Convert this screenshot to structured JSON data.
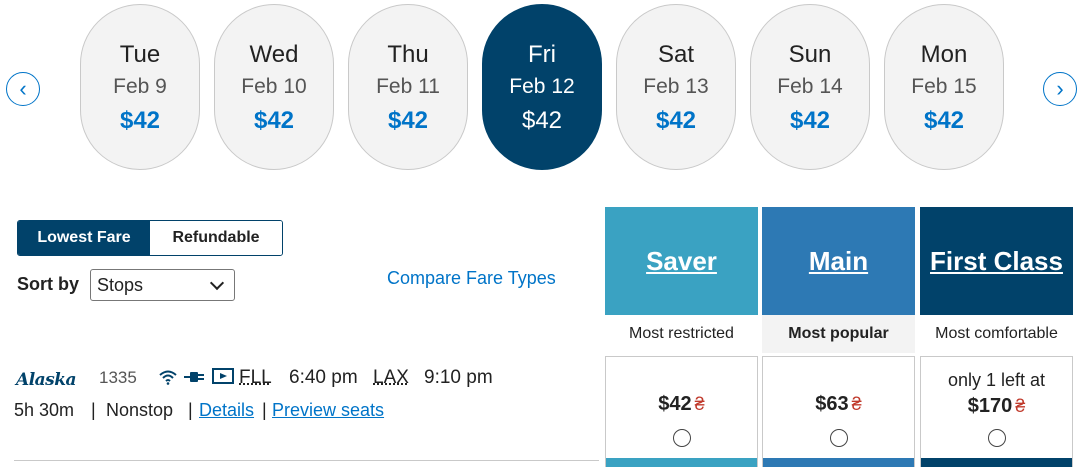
{
  "date_strip": {
    "prev_icon": "chevron-left-icon",
    "next_icon": "chevron-right-icon",
    "prev_glyph": "‹",
    "next_glyph": "›",
    "days": [
      {
        "dow": "Tue",
        "date": "Feb 9",
        "price": "$42",
        "selected": false
      },
      {
        "dow": "Wed",
        "date": "Feb 10",
        "price": "$42",
        "selected": false
      },
      {
        "dow": "Thu",
        "date": "Feb 11",
        "price": "$42",
        "selected": false
      },
      {
        "dow": "Fri",
        "date": "Feb 12",
        "price": "$42",
        "selected": true
      },
      {
        "dow": "Sat",
        "date": "Feb 13",
        "price": "$42",
        "selected": false
      },
      {
        "dow": "Sun",
        "date": "Feb 14",
        "price": "$42",
        "selected": false
      },
      {
        "dow": "Mon",
        "date": "Feb 15",
        "price": "$42",
        "selected": false
      }
    ]
  },
  "fare_toggle": {
    "lowest": "Lowest Fare",
    "refundable": "Refundable",
    "active": "lowest"
  },
  "sort": {
    "label": "Sort by",
    "value": "Stops"
  },
  "compare_link": "Compare Fare Types",
  "fare_types": {
    "saver": {
      "title": "Saver",
      "subtitle": "Most restricted",
      "color": "#3aa2c2"
    },
    "main": {
      "title": "Main",
      "subtitle": "Most popular",
      "color": "#2d79b4"
    },
    "first": {
      "title": "First Class",
      "subtitle": "Most comfortable",
      "color": "#01426a"
    }
  },
  "flight": {
    "airline": "Alaska",
    "number": "1335",
    "amenity_icons": [
      "wifi-icon",
      "power-outlet-icon",
      "streaming-entertainment-icon"
    ],
    "origin": "FLL",
    "departure": "6:40 pm",
    "destination": "LAX",
    "arrival": "9:10 pm",
    "duration": "5h 30m",
    "separator": "|",
    "stops": "Nonstop",
    "details_link": "Details",
    "seats_link": "Preview seats",
    "fares": {
      "saver": {
        "price": "$42"
      },
      "main": {
        "price": "$63"
      },
      "first": {
        "note": "only 1 left at",
        "price": "$170"
      }
    },
    "fare_leaf_icon": "green-leaf-icon"
  },
  "colors": {
    "brand_navy": "#01426a",
    "link_blue": "#0074c8"
  }
}
